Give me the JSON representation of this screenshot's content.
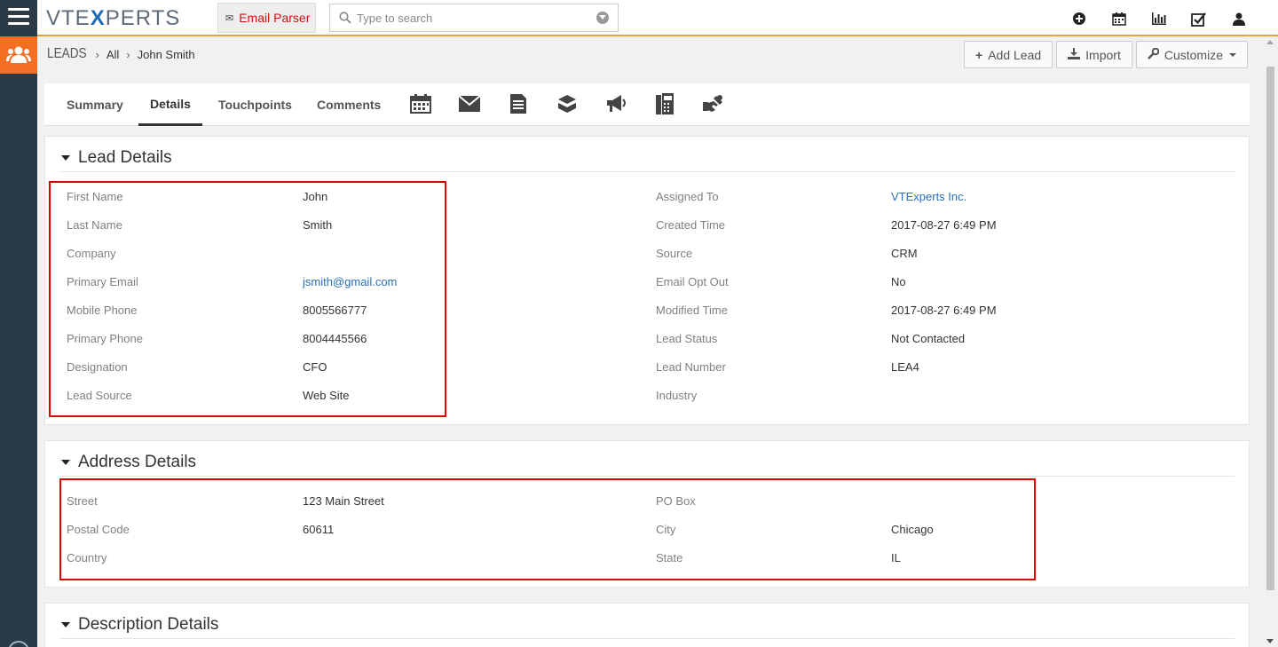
{
  "app": {
    "logo_text_a": "VTE",
    "logo_text_x": "X",
    "logo_text_b": "PERTS"
  },
  "topbar": {
    "email_parser_label": "Email Parser",
    "search_placeholder": "Type to search",
    "icons": [
      "add-circle-icon",
      "calendar-icon",
      "reports-icon",
      "tasks-checkbox-icon",
      "user-icon"
    ]
  },
  "breadcrumb": {
    "module": "LEADS",
    "filter": "All",
    "record": "John Smith"
  },
  "actions": {
    "add_lead": "Add Lead",
    "import": "Import",
    "customize": "Customize"
  },
  "tabs": [
    {
      "label": "Summary"
    },
    {
      "label": "Details"
    },
    {
      "label": "Touchpoints"
    },
    {
      "label": "Comments"
    }
  ],
  "tab_icons": [
    "calendar-icon",
    "envelope-icon",
    "document-icon",
    "box-icon",
    "megaphone-icon",
    "phone-icon",
    "handshake-icon"
  ],
  "lead_details": {
    "title": "Lead Details",
    "left": [
      {
        "label": "First Name",
        "value": "John"
      },
      {
        "label": "Last Name",
        "value": "Smith"
      },
      {
        "label": "Company",
        "value": ""
      },
      {
        "label": "Primary Email",
        "value": "jsmith@gmail.com"
      },
      {
        "label": "Mobile Phone",
        "value": "8005566777"
      },
      {
        "label": "Primary Phone",
        "value": "8004445566"
      },
      {
        "label": "Designation",
        "value": "CFO"
      },
      {
        "label": "Lead Source",
        "value": "Web Site"
      }
    ],
    "right": [
      {
        "label": "Assigned To",
        "value": "VTExperts Inc."
      },
      {
        "label": "Created Time",
        "value": "2017-08-27 6:49 PM"
      },
      {
        "label": "Source",
        "value": "CRM"
      },
      {
        "label": "Email Opt Out",
        "value": "No"
      },
      {
        "label": "Modified Time",
        "value": "2017-08-27 6:49 PM"
      },
      {
        "label": "Lead Status",
        "value": "Not Contacted"
      },
      {
        "label": "Lead Number",
        "value": "LEA4"
      },
      {
        "label": "Industry",
        "value": ""
      }
    ]
  },
  "address_details": {
    "title": "Address Details",
    "left": [
      {
        "label": "Street",
        "value": "123 Main Street"
      },
      {
        "label": "Postal Code",
        "value": "60611"
      },
      {
        "label": "Country",
        "value": ""
      }
    ],
    "right": [
      {
        "label": "PO Box",
        "value": ""
      },
      {
        "label": "City",
        "value": "Chicago"
      },
      {
        "label": "State",
        "value": "IL"
      }
    ]
  },
  "description_details": {
    "title": "Description Details"
  },
  "colors": {
    "rail": "#2b3a47",
    "module_accent": "#f36f21",
    "link": "#2a6fbd",
    "highlight": "#e00000"
  }
}
